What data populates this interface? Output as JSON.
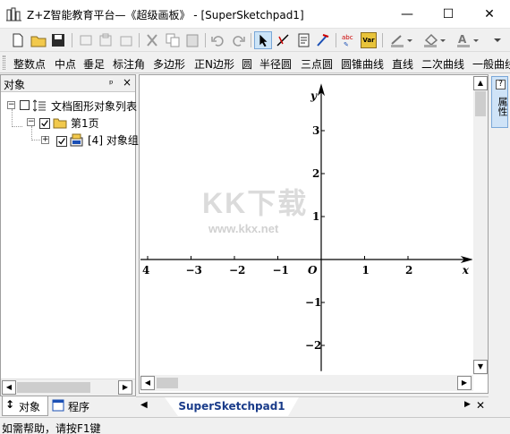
{
  "window": {
    "title": "Z+Z智能教育平台—《超级画板》 - [SuperSketchpad1]",
    "minimize": "—",
    "maximize": "☐",
    "close": "✕"
  },
  "toolbar": {
    "icons": [
      "new-icon",
      "open-icon",
      "save-icon",
      "cut-disabled-icon",
      "copy-disabled-icon",
      "paste-disabled-icon",
      "delete-icon",
      "copy-icon",
      "paste-icon",
      "undo-icon",
      "redo-icon",
      "select-arrow-icon",
      "draw-tool-icon",
      "text-tool-icon",
      "brush-tool-icon",
      "abc-text-icon",
      "variable-icon",
      "line-color-icon",
      "fill-color-icon",
      "text-color-icon"
    ],
    "var_label": "Var"
  },
  "construct_bar": {
    "items": [
      "整数点",
      "中点",
      "垂足",
      "标注角",
      "多边形",
      "正N边形",
      "圆",
      "半径圆",
      "三点圆",
      "圆锥曲线",
      "直线",
      "二次曲线",
      "一般曲线"
    ]
  },
  "object_panel": {
    "title": "对象",
    "pin": "ᵖ",
    "close": "×",
    "tree": {
      "root_label": "文档图形对象列表",
      "page_label": "第1页",
      "objects_label": "[4] 对象组"
    }
  },
  "left_tabs": {
    "object_tab": "对象",
    "program_tab": "程序"
  },
  "document_tabs": {
    "active_tab": "SuperSketchpad1"
  },
  "properties_strip": {
    "help": "?",
    "props_label": "属性"
  },
  "status_bar": {
    "text": "如需帮助，请按F1键"
  },
  "watermark": {
    "text": "KK下载",
    "url": "www.kkx.net"
  },
  "chart_data": {
    "type": "scatter",
    "title": "",
    "xlabel": "x",
    "ylabel": "y",
    "origin_label": "O",
    "x_ticks": [
      -4,
      -3,
      -2,
      -1,
      1,
      2
    ],
    "y_ticks": [
      -2,
      -1,
      1,
      2,
      3
    ],
    "x_tick_labels": [
      "4",
      "−3",
      "−2",
      "−1",
      "1",
      "2"
    ],
    "y_tick_labels": [
      "−2",
      "−1",
      "1",
      "2",
      "3"
    ],
    "xlim": [
      -4.3,
      3.5
    ],
    "ylim": [
      -2.6,
      4.1
    ],
    "grid": false,
    "series": []
  }
}
